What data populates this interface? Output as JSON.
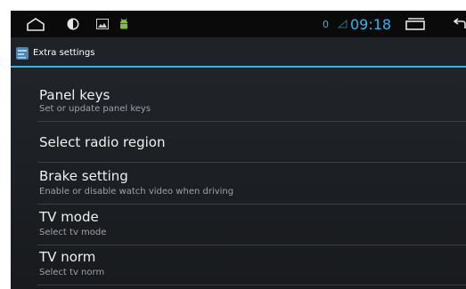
{
  "status_bar": {
    "notification_count": "0",
    "time": "09:18",
    "icons": [
      "home-icon",
      "brightness-icon",
      "image-icon",
      "android-icon",
      "signal-icon",
      "recent-apps-icon",
      "back-icon"
    ]
  },
  "action_bar": {
    "title": "Extra settings",
    "icon": "settings-app-icon"
  },
  "settings": [
    {
      "title": "Panel keys",
      "summary": "Set or update panel keys"
    },
    {
      "title": "Select radio region",
      "summary": ""
    },
    {
      "title": "Brake setting",
      "summary": "Enable or disable watch video when driving"
    },
    {
      "title": "TV mode",
      "summary": "Select tv mode"
    },
    {
      "title": "TV norm",
      "summary": "Select tv norm"
    }
  ],
  "colors": {
    "accent": "#33b5e5",
    "background": "#1f2227",
    "text_primary": "#f0f0f0",
    "text_secondary": "#9ea2a8"
  }
}
